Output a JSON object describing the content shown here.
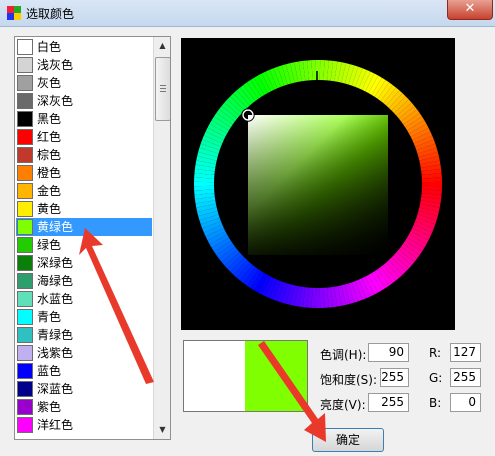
{
  "window": {
    "title": "选取颜色",
    "close_glyph": "✕"
  },
  "color_list": {
    "selected_index": 11,
    "items": [
      {
        "label": "白色",
        "color": "#ffffff"
      },
      {
        "label": "浅灰色",
        "color": "#d4d4d4"
      },
      {
        "label": "灰色",
        "color": "#a0a0a0"
      },
      {
        "label": "深灰色",
        "color": "#6a6a6a"
      },
      {
        "label": "黑色",
        "color": "#000000"
      },
      {
        "label": "红色",
        "color": "#ff0000"
      },
      {
        "label": "棕色",
        "color": "#c0392b"
      },
      {
        "label": "橙色",
        "color": "#ff8000"
      },
      {
        "label": "金色",
        "color": "#ffb400"
      },
      {
        "label": "黄色",
        "color": "#ffee00"
      },
      {
        "label": "黄绿色",
        "color": "#7fff00"
      },
      {
        "label": "绿色",
        "color": "#22cc00"
      },
      {
        "label": "深绿色",
        "color": "#0a7f0a"
      },
      {
        "label": "海绿色",
        "color": "#2e9e6f"
      },
      {
        "label": "水蓝色",
        "color": "#5fe0b8"
      },
      {
        "label": "青色",
        "color": "#00ffff"
      },
      {
        "label": "青绿色",
        "color": "#30c0c0"
      },
      {
        "label": "浅紫色",
        "color": "#c0b0f0"
      },
      {
        "label": "蓝色",
        "color": "#0000ff"
      },
      {
        "label": "深蓝色",
        "color": "#00008b"
      },
      {
        "label": "紫色",
        "color": "#9900cc"
      },
      {
        "label": "洋红色",
        "color": "#ff00ff"
      }
    ]
  },
  "picker": {
    "hue": 90,
    "current_color": "#7fff00",
    "previous_color": "#ffffff"
  },
  "fields": {
    "hue_label": "色调(H):",
    "hue_value": "90",
    "sat_label": "饱和度(S):",
    "sat_value": "255",
    "val_label": "亮度(V):",
    "val_value": "255",
    "r_label": "R:",
    "r_value": "127",
    "g_label": "G:",
    "g_value": "255",
    "b_label": "B:",
    "b_value": "0"
  },
  "buttons": {
    "ok": "确定"
  },
  "colors": {
    "selection": "#3399ff",
    "annotation_arrow": "#e8392b"
  }
}
